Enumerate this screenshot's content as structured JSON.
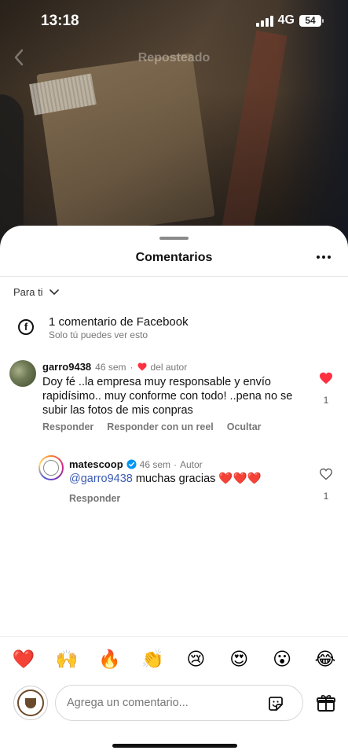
{
  "status_bar": {
    "time": "13:18",
    "network": "4G",
    "battery": "54"
  },
  "nav": {
    "title": "Reposteado"
  },
  "sheet": {
    "title": "Comentarios",
    "filter_label": "Para ti",
    "facebook": {
      "title": "1 comentario de Facebook",
      "subtitle": "Solo tú puedes ver esto"
    }
  },
  "comments": [
    {
      "username": "garro9438",
      "time": "46 sem",
      "separator": "·",
      "author_like": "del autor",
      "text": "Doy fé ..la empresa muy responsable y envío rapidísimo.. muy conforme con todo! ..pena no se subir las fotos de mis conpras",
      "actions": [
        "Responder",
        "Responder con un reel",
        "Ocultar"
      ],
      "likes": "1",
      "liked": true
    }
  ],
  "reply": {
    "username": "matescoop",
    "time": "46 sem",
    "separator": "·",
    "role": "Autor",
    "mention": "@garro9438",
    "text": " muchas gracias ❤️❤️❤️",
    "action": "Responder",
    "likes": "1",
    "liked": false
  },
  "emoji_bar": [
    "❤️",
    "🙌",
    "🔥",
    "👏",
    "😢",
    "😍",
    "😮",
    "😂"
  ],
  "composer": {
    "placeholder": "Agrega un comentario..."
  },
  "colors": {
    "like_red": "#ff3040",
    "mention_blue": "#3b5bb5",
    "verified_blue": "#0095f6"
  }
}
